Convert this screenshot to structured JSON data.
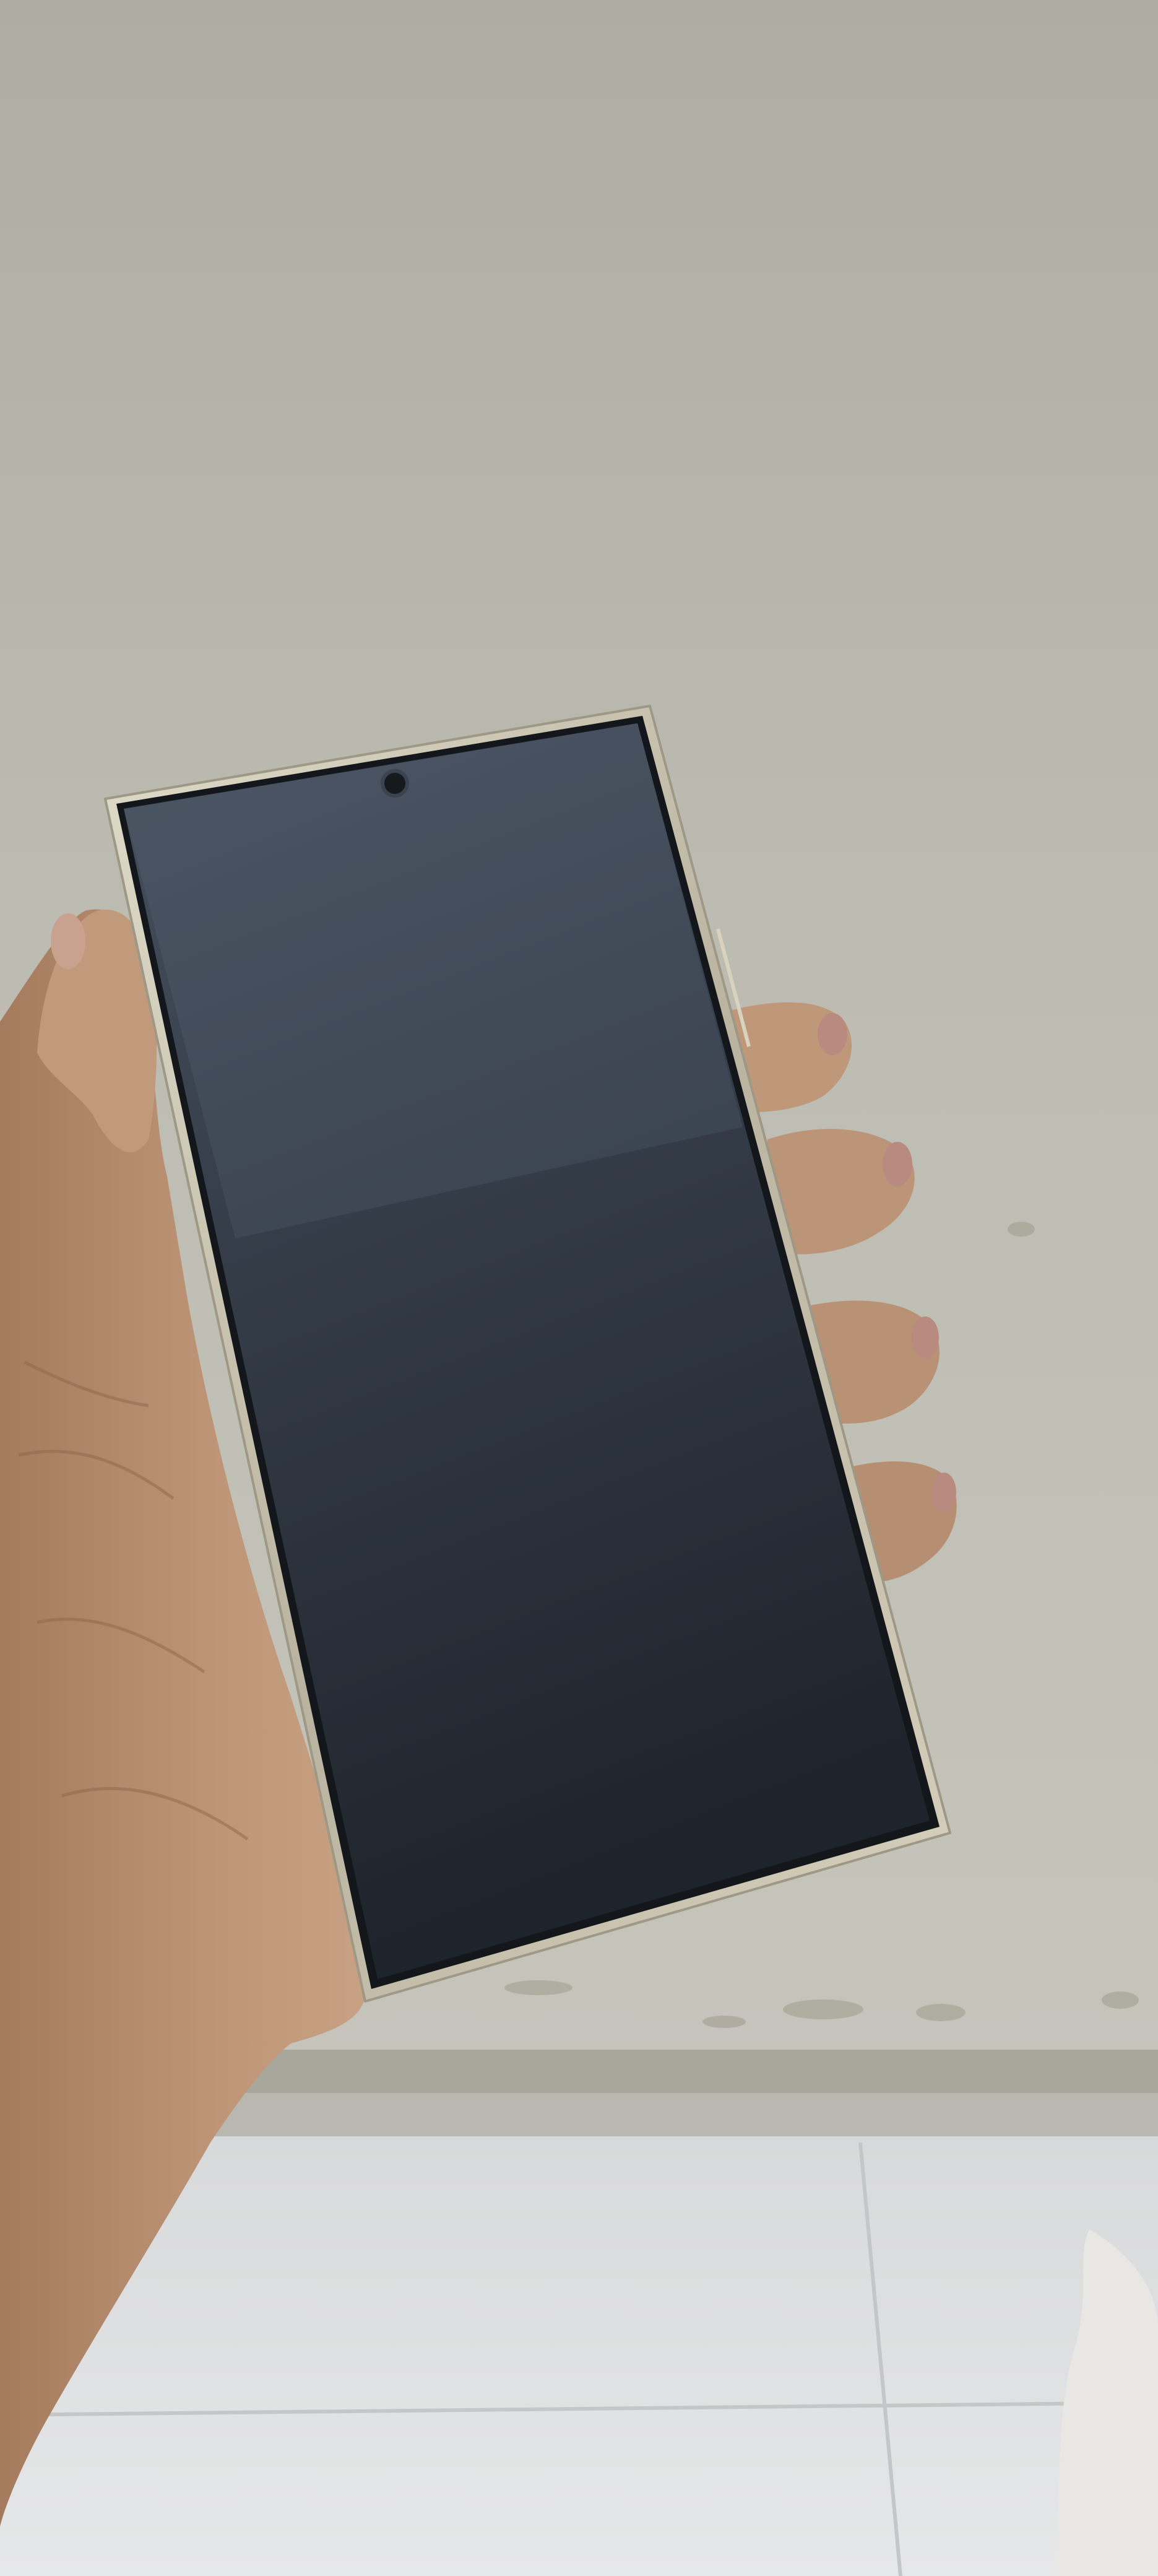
{
  "scene": {
    "subject": "hand-holding-smartphone",
    "colors": {
      "ceiling": "#b9b8ad",
      "ceiling_shadow": "#a9a89d",
      "wall_edge": "#c8c8c0",
      "floor_tile": "#dedfe0",
      "floor_grout": "#c6c7c9",
      "phone_frame": "#c9c3b0",
      "phone_screen_top": "#3b4350",
      "phone_screen_bottom": "#1f252c",
      "skin": "#b98f70",
      "skin_shadow": "#8e654b",
      "nail": "#b98b80"
    }
  }
}
